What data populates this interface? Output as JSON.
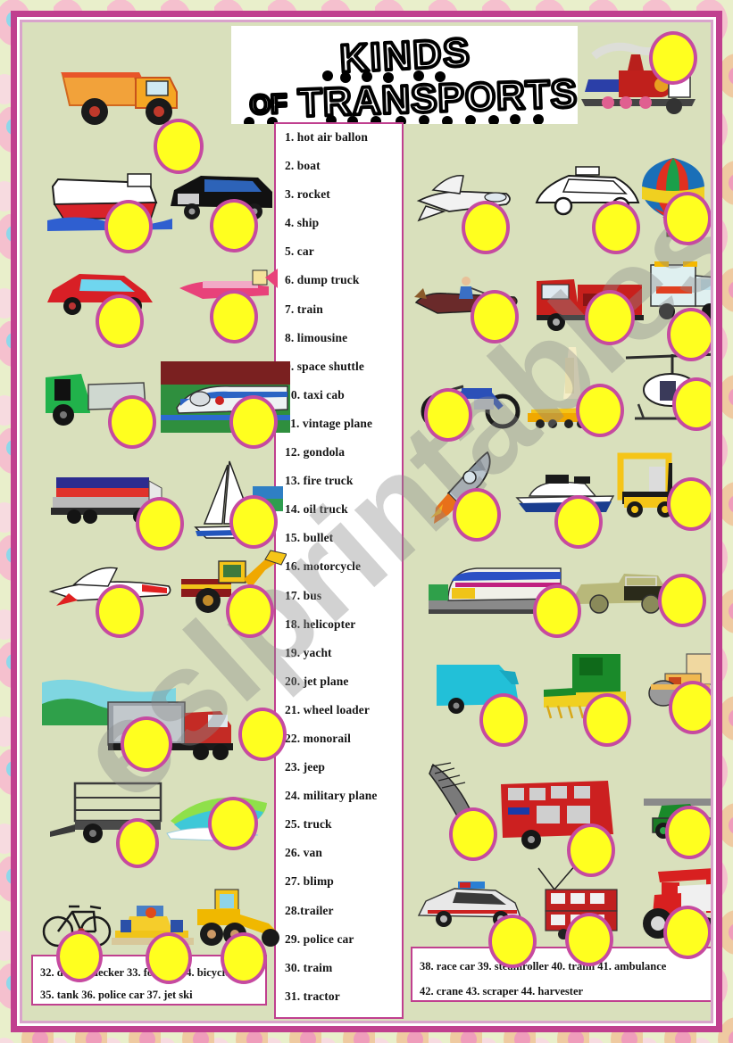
{
  "worksheet": {
    "title_line1": "KINDS",
    "title_line2_small": "OF",
    "title_line2": "TRANSPORTS",
    "title_full": "KINDS OF TRANSPORTS",
    "watermark": "eslprintables.com",
    "colors": {
      "page_background": "#e9efcb",
      "canvas_background": "#d9e0bc",
      "frame": "#c0408f",
      "answer_circle_fill": "#ffff1f",
      "answer_circle_border": "#c64aa0",
      "box_background": "#ffffff",
      "text": "#141414"
    }
  },
  "word_list": [
    "1. hot air ballon",
    "2. boat",
    "3. rocket",
    "4. ship",
    "5. car",
    "6. dump truck",
    "7. train",
    "8. limousine",
    "9. space shuttle",
    "10. taxi cab",
    "11. vintage plane",
    "12. gondola",
    "13. fire truck",
    "14. oil truck",
    "15. bullet",
    "16. motorcycle",
    "17. bus",
    "18. helicopter",
    "19. yacht",
    "20. jet plane",
    "21. wheel loader",
    "22. monorail",
    "23. jeep",
    "24. military plane",
    "25. truck",
    "26. van",
    "27. blimp",
    "28.trailer",
    "29. police car",
    "30. traim",
    "31. tractor"
  ],
  "bottom_left_box": {
    "line1": "32. double decker 33. forklift  34. bicycle",
    "line2": "35. tank  36. police car     37. jet ski"
  },
  "bottom_right_box": {
    "line1": "38. race car  39. steamroller   40. traim  41. ambulance",
    "line2": "42. crane        43. scraper      44. harvester"
  },
  "pictures": {
    "left": [
      "dump-truck",
      "ship",
      "limousine",
      "car",
      "vintage-plane",
      "green-truck",
      "bullet-train",
      "oil-truck",
      "sailboat-yacht",
      "jet-plane",
      "wheel-loader",
      "semi-truck",
      "trailer",
      "jet-ski",
      "bicycle",
      "race-car",
      "scraper"
    ],
    "right": [
      "steam-train",
      "military-plane",
      "taxi-cab",
      "hot-air-balloon",
      "gondola",
      "fire-truck",
      "ambulance",
      "motorcycle",
      "crane",
      "helicopter",
      "rocket",
      "boat-yacht",
      "forklift",
      "monorail",
      "jeep",
      "van",
      "harvester",
      "steamroller",
      "blimp",
      "double-decker-bus",
      "tank",
      "police-car",
      "tram",
      "tractor"
    ]
  }
}
